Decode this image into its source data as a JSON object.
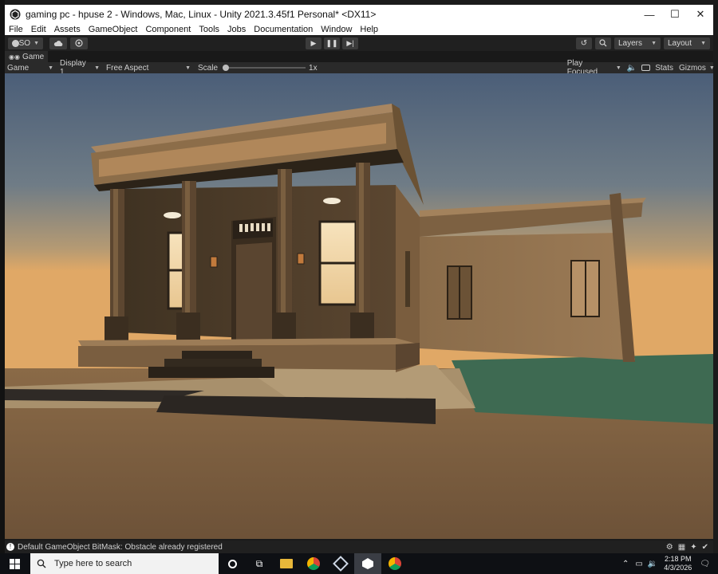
{
  "window": {
    "title": "gaming pc - hpuse 2 - Windows, Mac, Linux - Unity 2021.3.45f1 Personal* <DX11>",
    "controls": {
      "minimize": "—",
      "maximize": "☐",
      "close": "✕"
    }
  },
  "menu": [
    "File",
    "Edit",
    "Assets",
    "GameObject",
    "Component",
    "Tools",
    "Jobs",
    "Documentation",
    "Window",
    "Help"
  ],
  "toolbar": {
    "account": "SO",
    "layers": "Layers",
    "layout": "Layout"
  },
  "game_view": {
    "tab": "Game",
    "mode": "Game",
    "display": "Display 1",
    "aspect": "Free Aspect",
    "scale_label": "Scale",
    "scale_value": "1x",
    "play_focus": "Play Focused",
    "stats": "Stats",
    "gizmos": "Gizmos"
  },
  "status": {
    "message": "Default GameObject BitMask: Obstacle already registered"
  },
  "taskbar": {
    "search_placeholder": "Type here to search",
    "time": "2:18 PM",
    "date": "4/3/2026"
  },
  "colors": {
    "sky_top": "#4a5d78",
    "sky_horizon": "#d8a66a",
    "building": "#8a6d4c",
    "grass": "#3e6a52",
    "ground": "#7a5f42",
    "unity_dark": "#202020"
  }
}
